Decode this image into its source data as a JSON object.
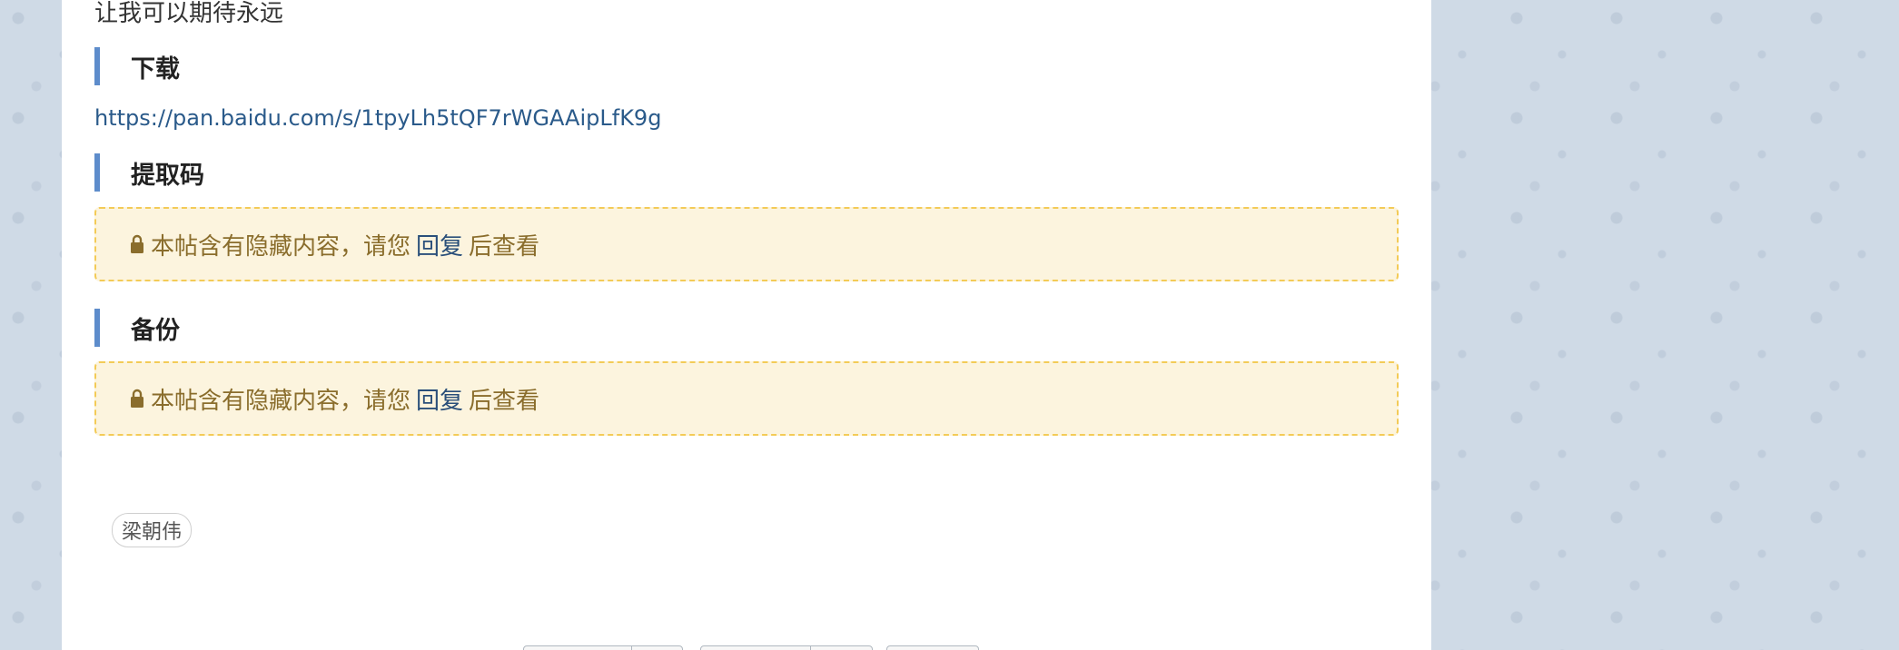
{
  "post": {
    "intro_text": "让我可以期待永远",
    "sections": {
      "download": {
        "heading": "下载",
        "link": "https://pan.baidu.com/s/1tpyLh5tQF7rWGAAipLfK9g"
      },
      "code": {
        "heading": "提取码"
      },
      "backup": {
        "heading": "备份"
      }
    },
    "hidden_notice": {
      "prefix": "本帖含有隐藏内容，请您",
      "reply_label": "回复",
      "suffix": "后查看"
    },
    "tags": [
      "梁朝伟"
    ]
  },
  "colors": {
    "accent_bar": "#5d8ccb",
    "notice_bg": "#fcf4de",
    "notice_border": "#f3cb57",
    "link": "#2a5a8a"
  },
  "icons": {
    "lock": "lock-icon"
  }
}
